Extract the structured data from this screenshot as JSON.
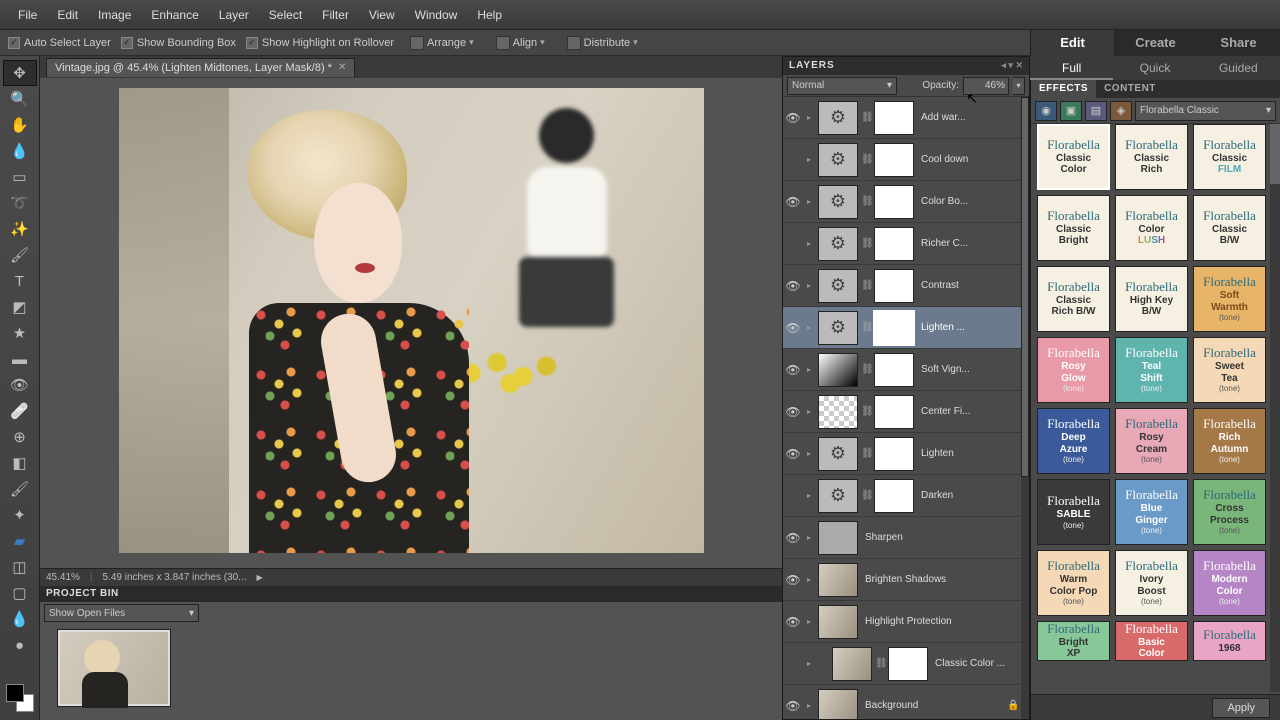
{
  "menu": {
    "items": [
      "File",
      "Edit",
      "Image",
      "Enhance",
      "Layer",
      "Select",
      "Filter",
      "View",
      "Window",
      "Help"
    ]
  },
  "options": {
    "auto_select": "Auto Select Layer",
    "bounding": "Show Bounding Box",
    "highlight": "Show Highlight on Rollover",
    "arrange": "Arrange",
    "align": "Align",
    "distribute": "Distribute"
  },
  "right_tabs": {
    "edit": "Edit",
    "create": "Create",
    "share": "Share"
  },
  "modes": {
    "full": "Full",
    "quick": "Quick",
    "guided": "Guided"
  },
  "doc_tab": {
    "title": "Vintage.jpg @ 45.4% (Lighten Midtones, Layer Mask/8) *"
  },
  "status": {
    "zoom": "45.41%",
    "dims": "5.49 inches x 3.847 inches (30..."
  },
  "project_bin": {
    "title": "PROJECT BIN",
    "selector": "Show Open Files"
  },
  "layers_panel": {
    "title": "LAYERS",
    "blend_mode": "Normal",
    "opacity_label": "Opacity:",
    "opacity_value": "46%",
    "layers": [
      {
        "name": "Add war...",
        "type": "adj",
        "eye": true,
        "mask": true
      },
      {
        "name": "Cool down",
        "type": "adj",
        "eye": false,
        "mask": true
      },
      {
        "name": "Color Bo...",
        "type": "adj",
        "eye": true,
        "mask": true
      },
      {
        "name": "Richer C...",
        "type": "adj",
        "eye": false,
        "mask": true
      },
      {
        "name": "Contrast",
        "type": "adj",
        "eye": true,
        "mask": true
      },
      {
        "name": "Lighten ...",
        "type": "adj",
        "eye": true,
        "mask": true,
        "selected": true
      },
      {
        "name": "Soft Vign...",
        "type": "grad",
        "eye": true,
        "mask": true
      },
      {
        "name": "Center Fi...",
        "type": "trans",
        "eye": true,
        "mask": true
      },
      {
        "name": "Lighten",
        "type": "adj",
        "eye": true,
        "mask": true
      },
      {
        "name": "Darken",
        "type": "adj",
        "eye": false,
        "mask": true
      },
      {
        "name": "Sharpen",
        "type": "solid",
        "eye": true,
        "mask": false,
        "nolink": true
      },
      {
        "name": "Brighten Shadows",
        "type": "img",
        "eye": true,
        "mask": false,
        "nolink": true
      },
      {
        "name": "Highlight Protection",
        "type": "img",
        "eye": true,
        "mask": false,
        "nolink": true
      },
      {
        "name": "Classic Color ...",
        "type": "img",
        "eye": false,
        "mask": true,
        "indent": true
      },
      {
        "name": "Background",
        "type": "img",
        "eye": true,
        "mask": false,
        "locked": true,
        "nolink": true
      }
    ]
  },
  "effects_panel": {
    "tab_effects": "EFFECTS",
    "tab_content": "CONTENT",
    "preset_selector": "Florabella Classic",
    "apply": "Apply",
    "items": [
      {
        "l1": "Classic",
        "l2": "Color",
        "bg": "bg-cream",
        "sel": true
      },
      {
        "l1": "Classic",
        "l2": "Rich",
        "bg": "bg-cream"
      },
      {
        "l1": "Classic",
        "l2": "FILM",
        "bg": "bg-cream",
        "c2": "#4aa8b8"
      },
      {
        "l1": "Classic",
        "l2": "Bright",
        "bg": "bg-cream"
      },
      {
        "l1": "Color",
        "l2": "LUSH",
        "bg": "bg-cream",
        "rainbow": true
      },
      {
        "l1": "Classic",
        "l2": "B/W",
        "bg": "bg-cream"
      },
      {
        "l1": "Classic",
        "l2": "Rich B/W",
        "bg": "bg-cream"
      },
      {
        "l1": "High Key",
        "l2": "B/W",
        "bg": "bg-cream"
      },
      {
        "l1": "Soft",
        "l2": "Warmth",
        "bg": "bg-orange",
        "sub": "(tone)"
      },
      {
        "l1": "Rosy",
        "l2": "Glow",
        "bg": "bg-pink",
        "sub": "(tone)",
        "light": true
      },
      {
        "l1": "Teal",
        "l2": "Shift",
        "bg": "bg-teal",
        "sub": "(tone)",
        "light": true
      },
      {
        "l1": "Sweet",
        "l2": "Tea",
        "bg": "bg-peach",
        "sub": "(tone)"
      },
      {
        "l1": "Deep",
        "l2": "Azure",
        "bg": "bg-blue",
        "sub": "(tone)",
        "light": true
      },
      {
        "l1": "Rosy",
        "l2": "Cream",
        "bg": "bg-rose",
        "sub": "(tone)"
      },
      {
        "l1": "Rich",
        "l2": "Autumn",
        "bg": "bg-brown",
        "sub": "(tone)",
        "light": true
      },
      {
        "l1": "",
        "l2": "SABLE",
        "bg": "bg-dark",
        "sub": "(tone)",
        "light": true
      },
      {
        "l1": "Blue",
        "l2": "Ginger",
        "bg": "bg-bluegr",
        "sub": "(tone)",
        "light": true
      },
      {
        "l1": "Cross",
        "l2": "Process",
        "bg": "bg-green",
        "sub": "(tone)"
      },
      {
        "l1": "Warm",
        "l2": "Color Pop",
        "bg": "bg-peach",
        "sub": "(tone)"
      },
      {
        "l1": "Ivory",
        "l2": "Boost",
        "bg": "bg-cream",
        "sub": "(tone)"
      },
      {
        "l1": "Modern",
        "l2": "Color",
        "bg": "bg-purple",
        "sub": "(tone)",
        "light": true
      },
      {
        "l1": "Bright",
        "l2": "XP",
        "bg": "bg-mint",
        "sub": "",
        "clip": true
      },
      {
        "l1": "Basic",
        "l2": "Color",
        "bg": "bg-red",
        "sub": "",
        "light": true,
        "clip": true
      },
      {
        "l1": "",
        "l2": "1968",
        "bg": "bg-pink2",
        "sub": "",
        "clip": true
      }
    ]
  }
}
